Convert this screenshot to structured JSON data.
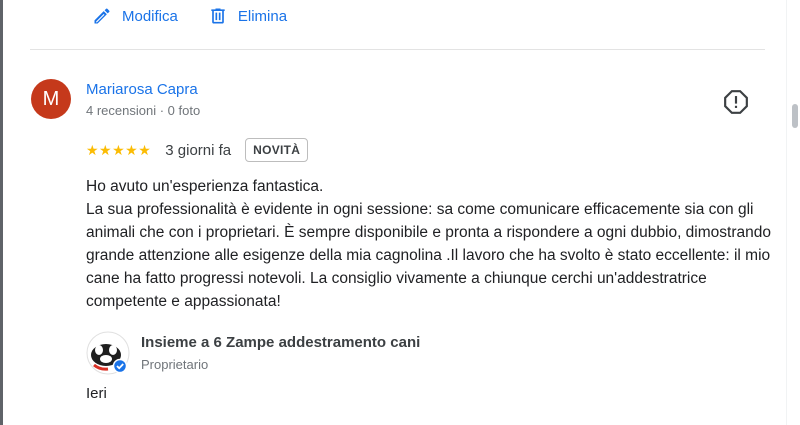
{
  "actions": {
    "edit_label": "Modifica",
    "delete_label": "Elimina"
  },
  "review": {
    "avatar_initial": "M",
    "author": "Mariarosa Capra",
    "meta": "4 recensioni · 0 foto",
    "rating": 5,
    "stars": "★★★★★",
    "date": "3 giorni fa",
    "badge": "NOVITÀ",
    "text": "Ho avuto un'esperienza fantastica.\nLa sua professionalità è evidente in ogni sessione: sa come comunicare efficacemente sia con gli animali che con i proprietari. È sempre disponibile e pronta a rispondere a ogni dubbio, dimostrando grande attenzione alle esigenze della mia cagnolina .Il lavoro che ha svolto è stato eccellente: il mio cane ha fatto progressi notevoli. La consiglio vivamente a chiunque cerchi un'addestratrice competente e appassionata!"
  },
  "owner_reply": {
    "name": "Insieme a 6 Zampe addestramento cani",
    "role": "Proprietario",
    "date": "Ieri"
  },
  "colors": {
    "link": "#1a73e8",
    "star": "#fbbc04",
    "avatar_bg": "#c5391b",
    "verified": "#1a73e8"
  }
}
